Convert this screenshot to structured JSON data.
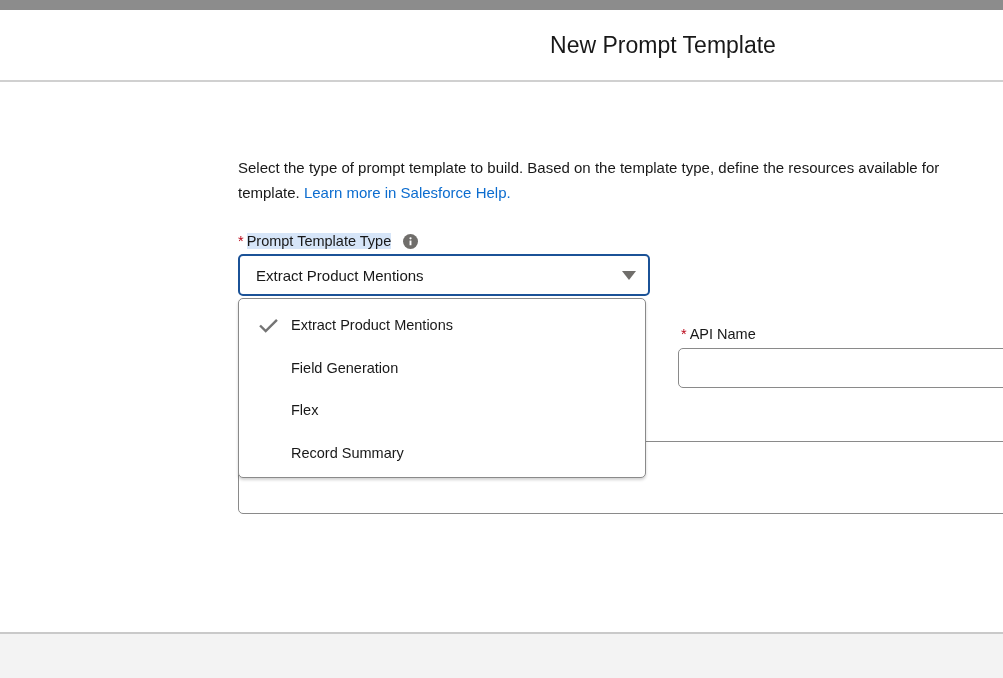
{
  "modal": {
    "title": "New Prompt Template"
  },
  "description": {
    "line_1": "Select the type of prompt template to build. Based on the template type, define the resources available for",
    "line_2": "template. ",
    "link": "Learn more in Salesforce Help."
  },
  "template_type": {
    "required_mark": "*",
    "label": "Prompt Template Type",
    "value": "Extract Product Mentions",
    "expanded": true,
    "options": [
      {
        "label": "Extract Product Mentions",
        "selected": true
      },
      {
        "label": "Field Generation",
        "selected": false
      },
      {
        "label": "Flex",
        "selected": false
      },
      {
        "label": "Record Summary",
        "selected": false
      }
    ]
  },
  "api_name": {
    "required_mark": "*",
    "label": "API Name"
  }
}
